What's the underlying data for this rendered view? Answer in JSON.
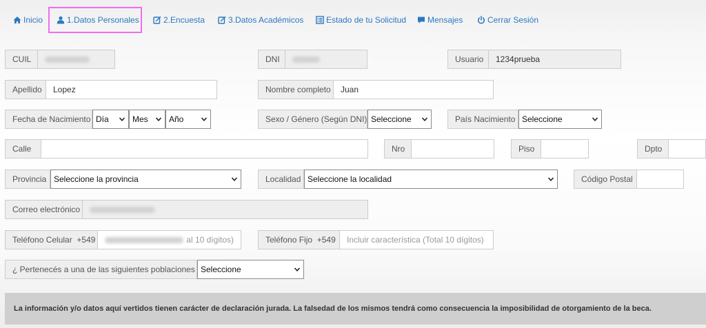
{
  "nav": {
    "inicio": "Inicio",
    "datos_personales": "1.Datos Personales",
    "encuesta": "2.Encuesta",
    "datos_academicos": "3.Datos Académicos",
    "estado": "Estado de tu Solicitud",
    "mensajes": "Mensajes",
    "cerrar": "Cerrar Sesión"
  },
  "form": {
    "cuil_label": "CUIL",
    "dni_label": "DNI",
    "usuario_label": "Usuario",
    "usuario_value": "1234prueba",
    "apellido_label": "Apellido",
    "apellido_value": "Lopez",
    "nombre_label": "Nombre completo",
    "nombre_value": "Juan",
    "fecha_label": "Fecha de Nacimiento",
    "dia": "Día",
    "mes": "Mes",
    "anio": "Año",
    "sexo_label": "Sexo / Género (Según DNI)",
    "sexo_value": "Seleccione",
    "pais_label": "País Nacimiento",
    "pais_value": "Seleccione",
    "calle_label": "Calle",
    "nro_label": "Nro",
    "piso_label": "Piso",
    "dpto_label": "Dpto",
    "provincia_label": "Provincia",
    "provincia_value": "Seleccione la provincia",
    "localidad_label": "Localidad",
    "localidad_value": "Seleccione la localidad",
    "cp_label": "Código Postal",
    "correo_label": "Correo electrónico",
    "cel_label": "Teléfono Celular",
    "cel_prefix": "+549",
    "cel_placeholder_tail": "al 10 dígitos)",
    "fijo_label": "Teléfono Fijo",
    "fijo_prefix": "+549",
    "fijo_placeholder": "Incluir característica (Total 10 dígitos)",
    "poblaciones_label": "¿ Pertenecés a una de las siguientes poblaciones ?",
    "poblaciones_value": "Seleccione"
  },
  "notice": "La información y/o datos aquí vertidos tienen carácter de declaración jurada. La falsedad de los mismos tendrá como consecuencia la imposibilidad de otorgamiento de la beca.",
  "colors": {
    "link": "#2b78c2",
    "active_outline": "#f26bf0",
    "addon_bg": "#eeeeee",
    "notice_bg": "#cfcfcf"
  },
  "icons": [
    "home-icon",
    "user-icon",
    "edit-icon",
    "list-icon",
    "chat-icon",
    "power-icon",
    "chevron-down-icon"
  ]
}
